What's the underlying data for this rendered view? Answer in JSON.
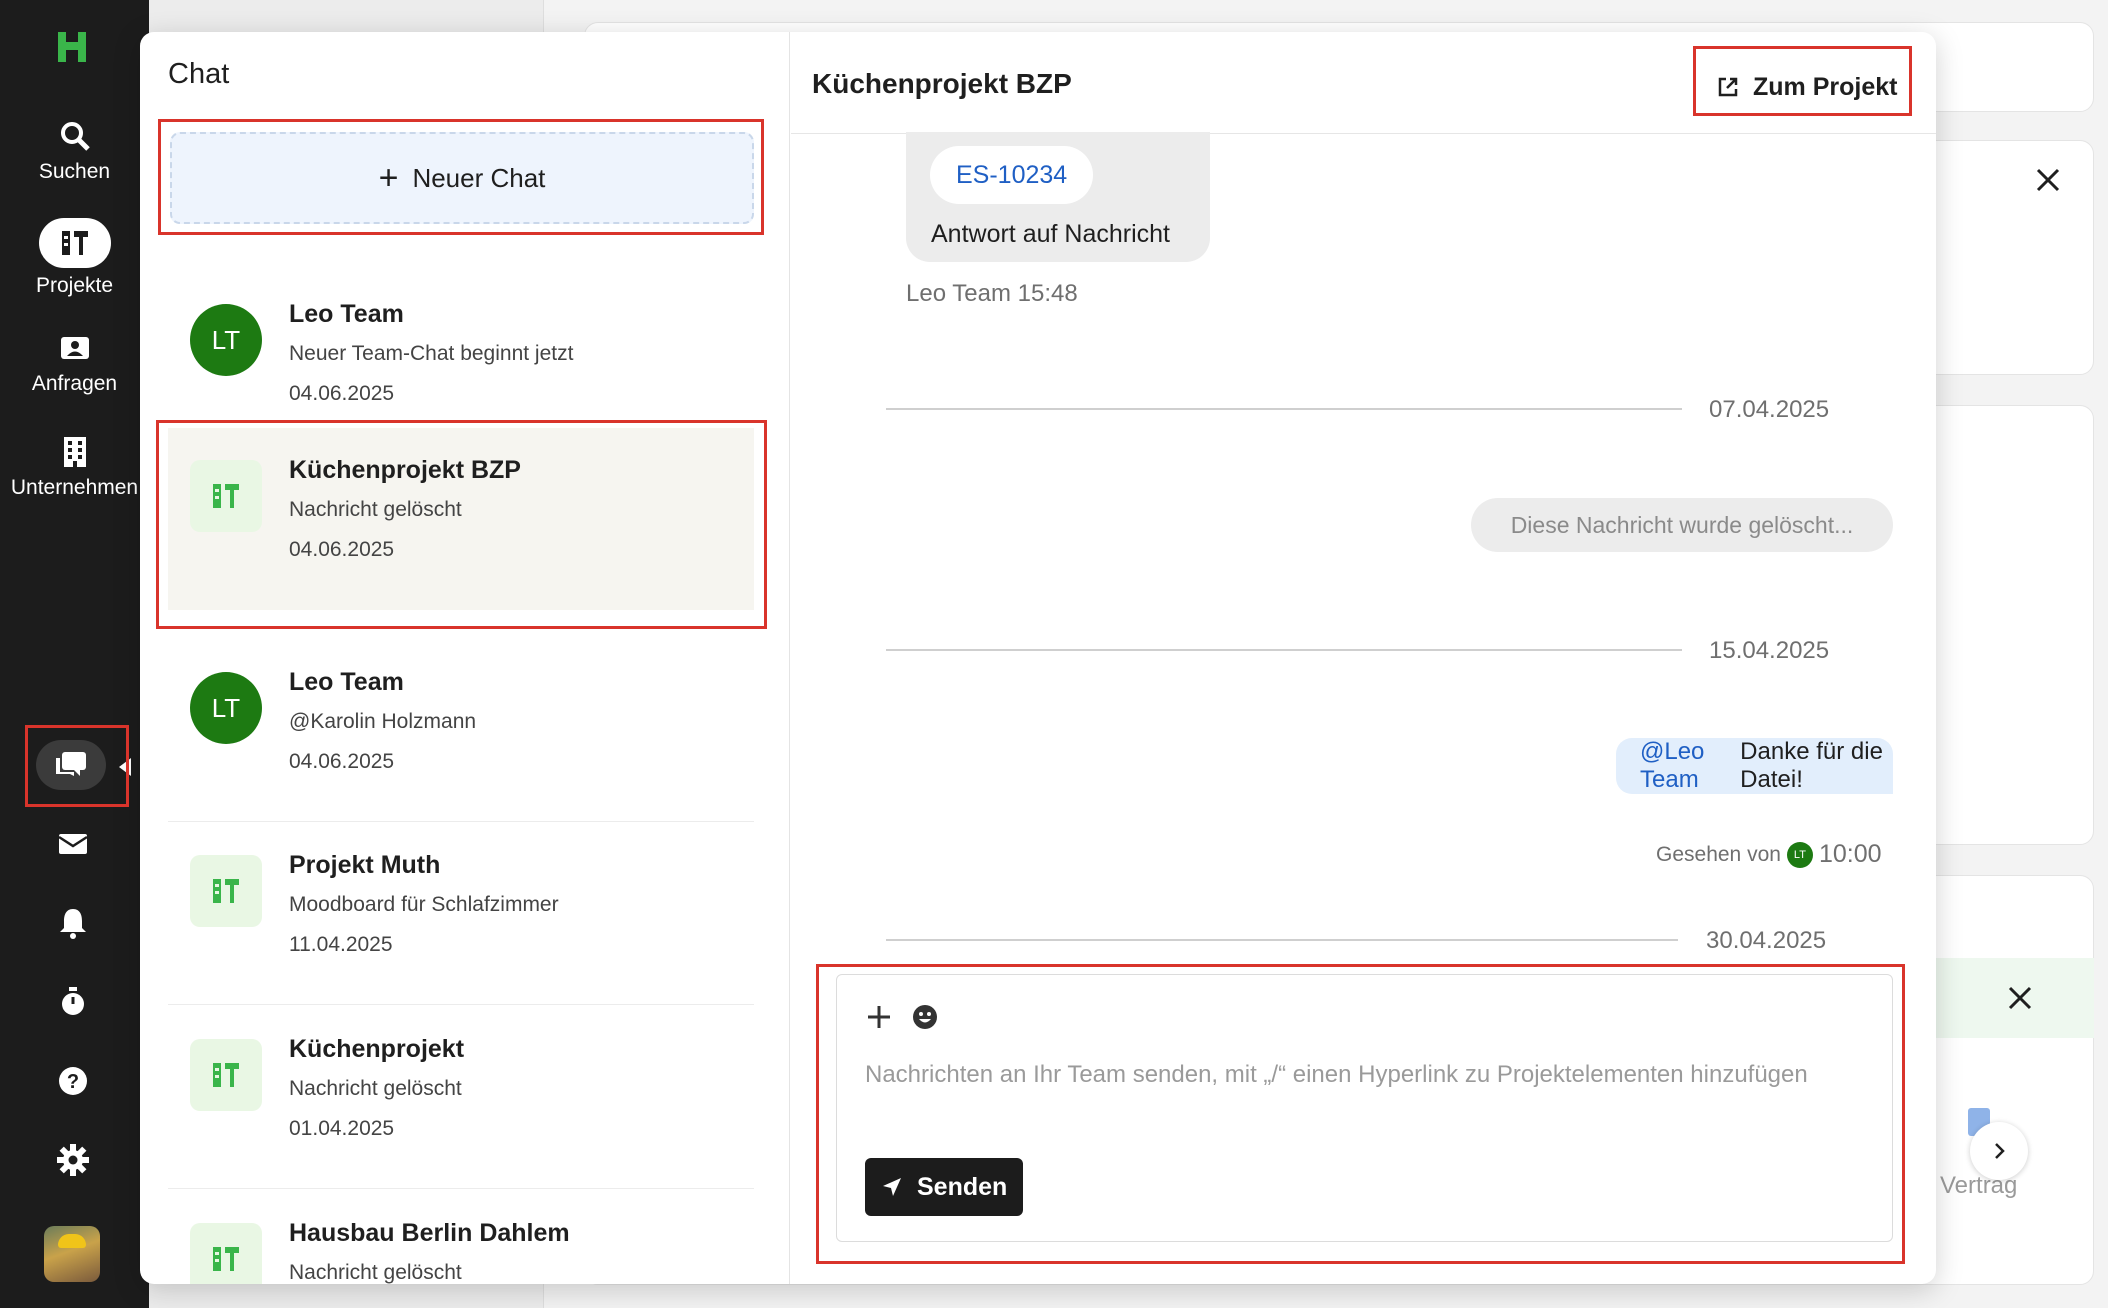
{
  "nav": {
    "items": [
      {
        "label": "Suchen",
        "icon": "search-icon"
      },
      {
        "label": "Projekte",
        "icon": "projects-icon"
      },
      {
        "label": "Anfragen",
        "icon": "requests-icon"
      },
      {
        "label": "Unternehmen",
        "icon": "company-icon"
      }
    ],
    "bottom_icons": [
      "chat-icon",
      "mail-icon",
      "bell-icon",
      "timer-icon",
      "help-icon",
      "settings-icon"
    ],
    "accent": "#3ab54a"
  },
  "chat_list": {
    "title": "Chat",
    "new_chat_label": "Neuer Chat",
    "rows": [
      {
        "title": "Leo Team",
        "message": "Neuer Team-Chat beginnt jetzt",
        "date": "04.06.2025",
        "avatar": "LT"
      },
      {
        "title": "Küchenprojekt BZP",
        "message": "Nachricht gelöscht",
        "date": "04.06.2025",
        "avatar": "project-icon"
      },
      {
        "title": "Leo Team",
        "message": "@Karolin Holzmann",
        "date": "04.06.2025",
        "avatar": "LT"
      },
      {
        "title": "Projekt Muth",
        "message": "Moodboard für Schlafzimmer",
        "date": "11.04.2025",
        "avatar": "project-icon"
      },
      {
        "title": "Küchenprojekt",
        "message": "Nachricht gelöscht",
        "date": "01.04.2025",
        "avatar": "project-icon"
      },
      {
        "title": "Hausbau Berlin Dahlem",
        "message": "Nachricht gelöscht",
        "date": "",
        "avatar": "project-icon"
      }
    ]
  },
  "conversation": {
    "title": "Küchenprojekt BZP",
    "to_project_label": "Zum Projekt",
    "reply_chip": "ES-10234",
    "reply_text": "Antwort auf Nachricht",
    "reply_meta": "Leo Team 15:48",
    "dividers": [
      "07.04.2025",
      "15.04.2025",
      "30.04.2025"
    ],
    "deleted_text": "Diese Nachricht wurde gelöscht...",
    "my_message_mention": "@Leo Team",
    "my_message_text": "Danke für die Datei!",
    "seen_label": "Gesehen von",
    "seen_avatar": "LT",
    "seen_time": "10:00"
  },
  "composer": {
    "placeholder": "Nachrichten an Ihr Team senden, mit „/“ einen Hyperlink zu Projektelementen hinzufügen",
    "send_label": "Senden"
  },
  "background": {
    "doc_label": "Vertrag"
  }
}
